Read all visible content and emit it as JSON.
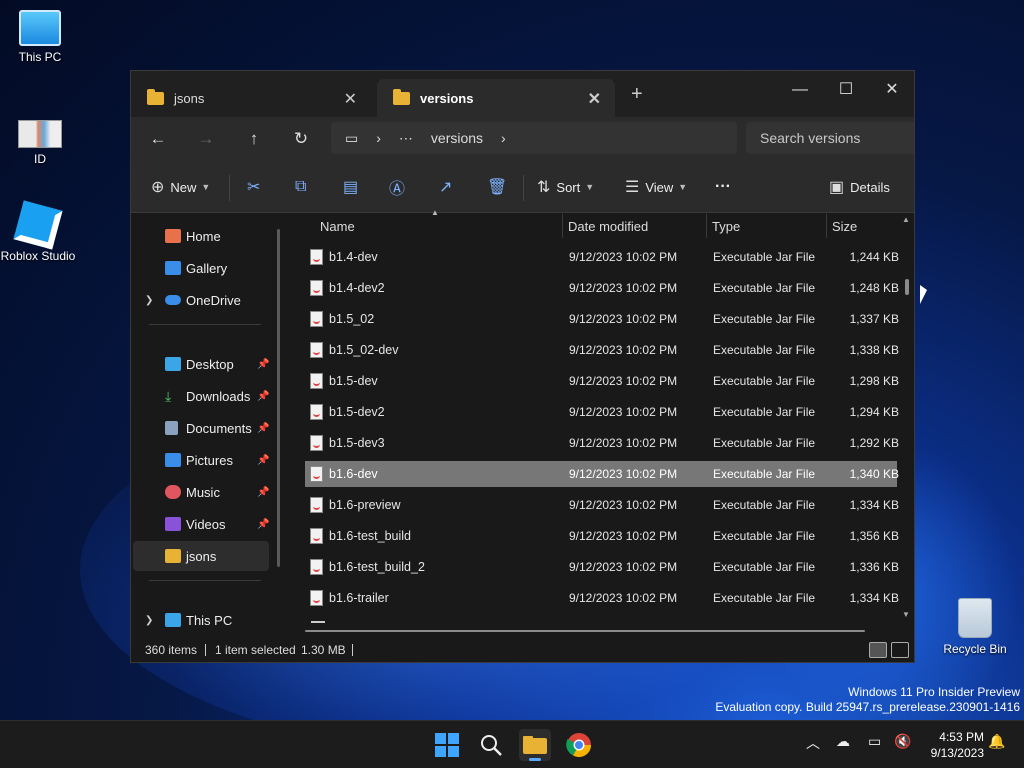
{
  "desktop": {
    "icons": [
      {
        "label": "This PC"
      },
      {
        "label": "ID"
      },
      {
        "label": "Roblox Studio"
      },
      {
        "label": "Recycle Bin"
      }
    ],
    "watermark": {
      "line1": "Windows 11 Pro Insider Preview",
      "line2": "Evaluation copy. Build 25947.rs_prerelease.230901-1416"
    }
  },
  "window": {
    "tabs": [
      {
        "label": "jsons",
        "active": false
      },
      {
        "label": "versions",
        "active": true
      }
    ],
    "new_tab": "+",
    "controls": {
      "minimize": "—",
      "maximize": "☐",
      "close": "✕"
    },
    "address": {
      "breadcrumb": [
        "⋯",
        "versions"
      ],
      "search_placeholder": "Search versions"
    },
    "commands": {
      "new_label": "New",
      "sort_label": "Sort",
      "view_label": "View",
      "more_label": "···",
      "details_label": "Details"
    },
    "nav": {
      "home": "Home",
      "gallery": "Gallery",
      "onedrive": "OneDrive",
      "desktop": "Desktop",
      "downloads": "Downloads",
      "documents": "Documents",
      "pictures": "Pictures",
      "music": "Music",
      "videos": "Videos",
      "jsons": "jsons",
      "this_pc": "This PC"
    },
    "columns": {
      "name": "Name",
      "date": "Date modified",
      "type": "Type",
      "size": "Size"
    },
    "files": [
      {
        "name": "b1.4-dev",
        "date": "9/12/2023 10:02 PM",
        "type": "Executable Jar File",
        "size": "1,244 KB",
        "selected": false
      },
      {
        "name": "b1.4-dev2",
        "date": "9/12/2023 10:02 PM",
        "type": "Executable Jar File",
        "size": "1,248 KB",
        "selected": false
      },
      {
        "name": "b1.5_02",
        "date": "9/12/2023 10:02 PM",
        "type": "Executable Jar File",
        "size": "1,337 KB",
        "selected": false
      },
      {
        "name": "b1.5_02-dev",
        "date": "9/12/2023 10:02 PM",
        "type": "Executable Jar File",
        "size": "1,338 KB",
        "selected": false
      },
      {
        "name": "b1.5-dev",
        "date": "9/12/2023 10:02 PM",
        "type": "Executable Jar File",
        "size": "1,298 KB",
        "selected": false
      },
      {
        "name": "b1.5-dev2",
        "date": "9/12/2023 10:02 PM",
        "type": "Executable Jar File",
        "size": "1,294 KB",
        "selected": false
      },
      {
        "name": "b1.5-dev3",
        "date": "9/12/2023 10:02 PM",
        "type": "Executable Jar File",
        "size": "1,292 KB",
        "selected": false
      },
      {
        "name": "b1.6-dev",
        "date": "9/12/2023 10:02 PM",
        "type": "Executable Jar File",
        "size": "1,340 KB",
        "selected": true
      },
      {
        "name": "b1.6-preview",
        "date": "9/12/2023 10:02 PM",
        "type": "Executable Jar File",
        "size": "1,334 KB",
        "selected": false
      },
      {
        "name": "b1.6-test_build",
        "date": "9/12/2023 10:02 PM",
        "type": "Executable Jar File",
        "size": "1,356 KB",
        "selected": false
      },
      {
        "name": "b1.6-test_build_2",
        "date": "9/12/2023 10:02 PM",
        "type": "Executable Jar File",
        "size": "1,336 KB",
        "selected": false
      },
      {
        "name": "b1.6-trailer",
        "date": "9/12/2023 10:02 PM",
        "type": "Executable Jar File",
        "size": "1,334 KB",
        "selected": false
      }
    ],
    "status": {
      "items": "360 items",
      "selected": "1 item selected",
      "size": "1.30 MB"
    }
  },
  "taskbar": {
    "clock_time": "4:53 PM",
    "clock_date": "9/13/2023"
  },
  "colors": {
    "accent": "#7fb2ff",
    "folder": "#e8b234",
    "selected_row": "#777777"
  }
}
